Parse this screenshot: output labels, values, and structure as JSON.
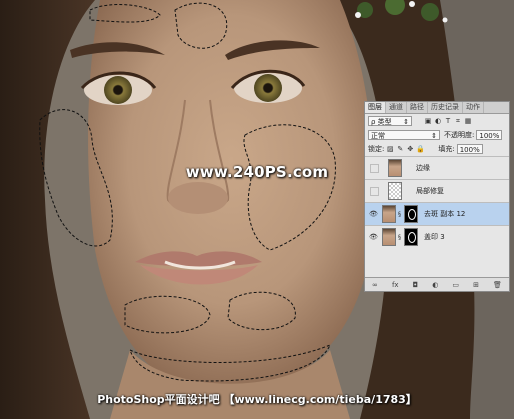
{
  "watermark": {
    "center": "www.240PS.com",
    "bottom": "PhotoShop平面设计吧 【www.linecg.com/tieba/1783】"
  },
  "layers_panel": {
    "tabs": [
      "图层",
      "通道",
      "路径",
      "历史记录",
      "动作"
    ],
    "active_tab": "图层",
    "filter": {
      "label": "ρ 类型",
      "arrow": "⇕",
      "icons": [
        "▣",
        "◐",
        "T",
        "⌗",
        "▦"
      ]
    },
    "blend": {
      "mode": "正常",
      "opacity_label": "不透明度:",
      "opacity_value": "100%"
    },
    "lock": {
      "label": "锁定:",
      "icons": [
        "▨",
        "✎",
        "✥",
        "🔒"
      ],
      "fill_label": "填充:",
      "fill_value": "100%"
    },
    "layers": [
      {
        "name": "边缘",
        "visible": false,
        "thumb": "face",
        "mask": false,
        "selected": false
      },
      {
        "name": "局部修复",
        "visible": false,
        "thumb": "blank",
        "mask": false,
        "selected": false
      },
      {
        "name": "去斑 副本 12",
        "visible": true,
        "thumb": "face",
        "mask": true,
        "selected": true
      },
      {
        "name": "盖印 3",
        "visible": true,
        "thumb": "face",
        "mask": true,
        "selected": false
      }
    ],
    "footer_icons": [
      "∞",
      "fx",
      "◘",
      "◐",
      "▭",
      "⊞",
      "🗑"
    ]
  }
}
